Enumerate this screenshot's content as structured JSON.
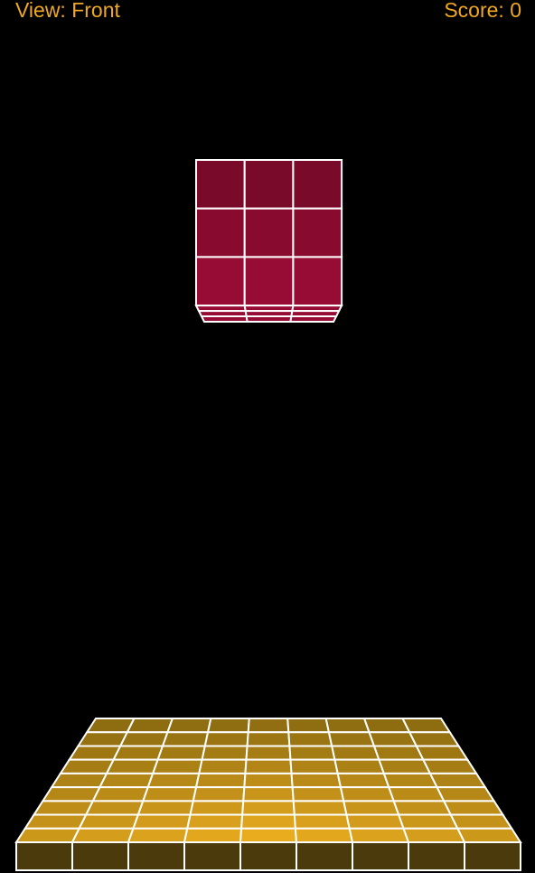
{
  "hud": {
    "view_label": "View: Front",
    "score_label": "Score: 0"
  },
  "colors": {
    "background": "#000000",
    "hud_text": "#f0a820",
    "grid_line": "#ffffff",
    "piece_top": "#7a0a2a",
    "piece_bottom": "#960c34",
    "floor_back": "#8a6a10",
    "floor_front": "#f0b020",
    "floor_side": "#4a3a0c"
  },
  "game": {
    "view": "Front",
    "score": 0,
    "piece": {
      "cols": 3,
      "rows": 3,
      "depth_layers": 3
    },
    "floor": {
      "cols": 9,
      "rows": 9
    }
  }
}
